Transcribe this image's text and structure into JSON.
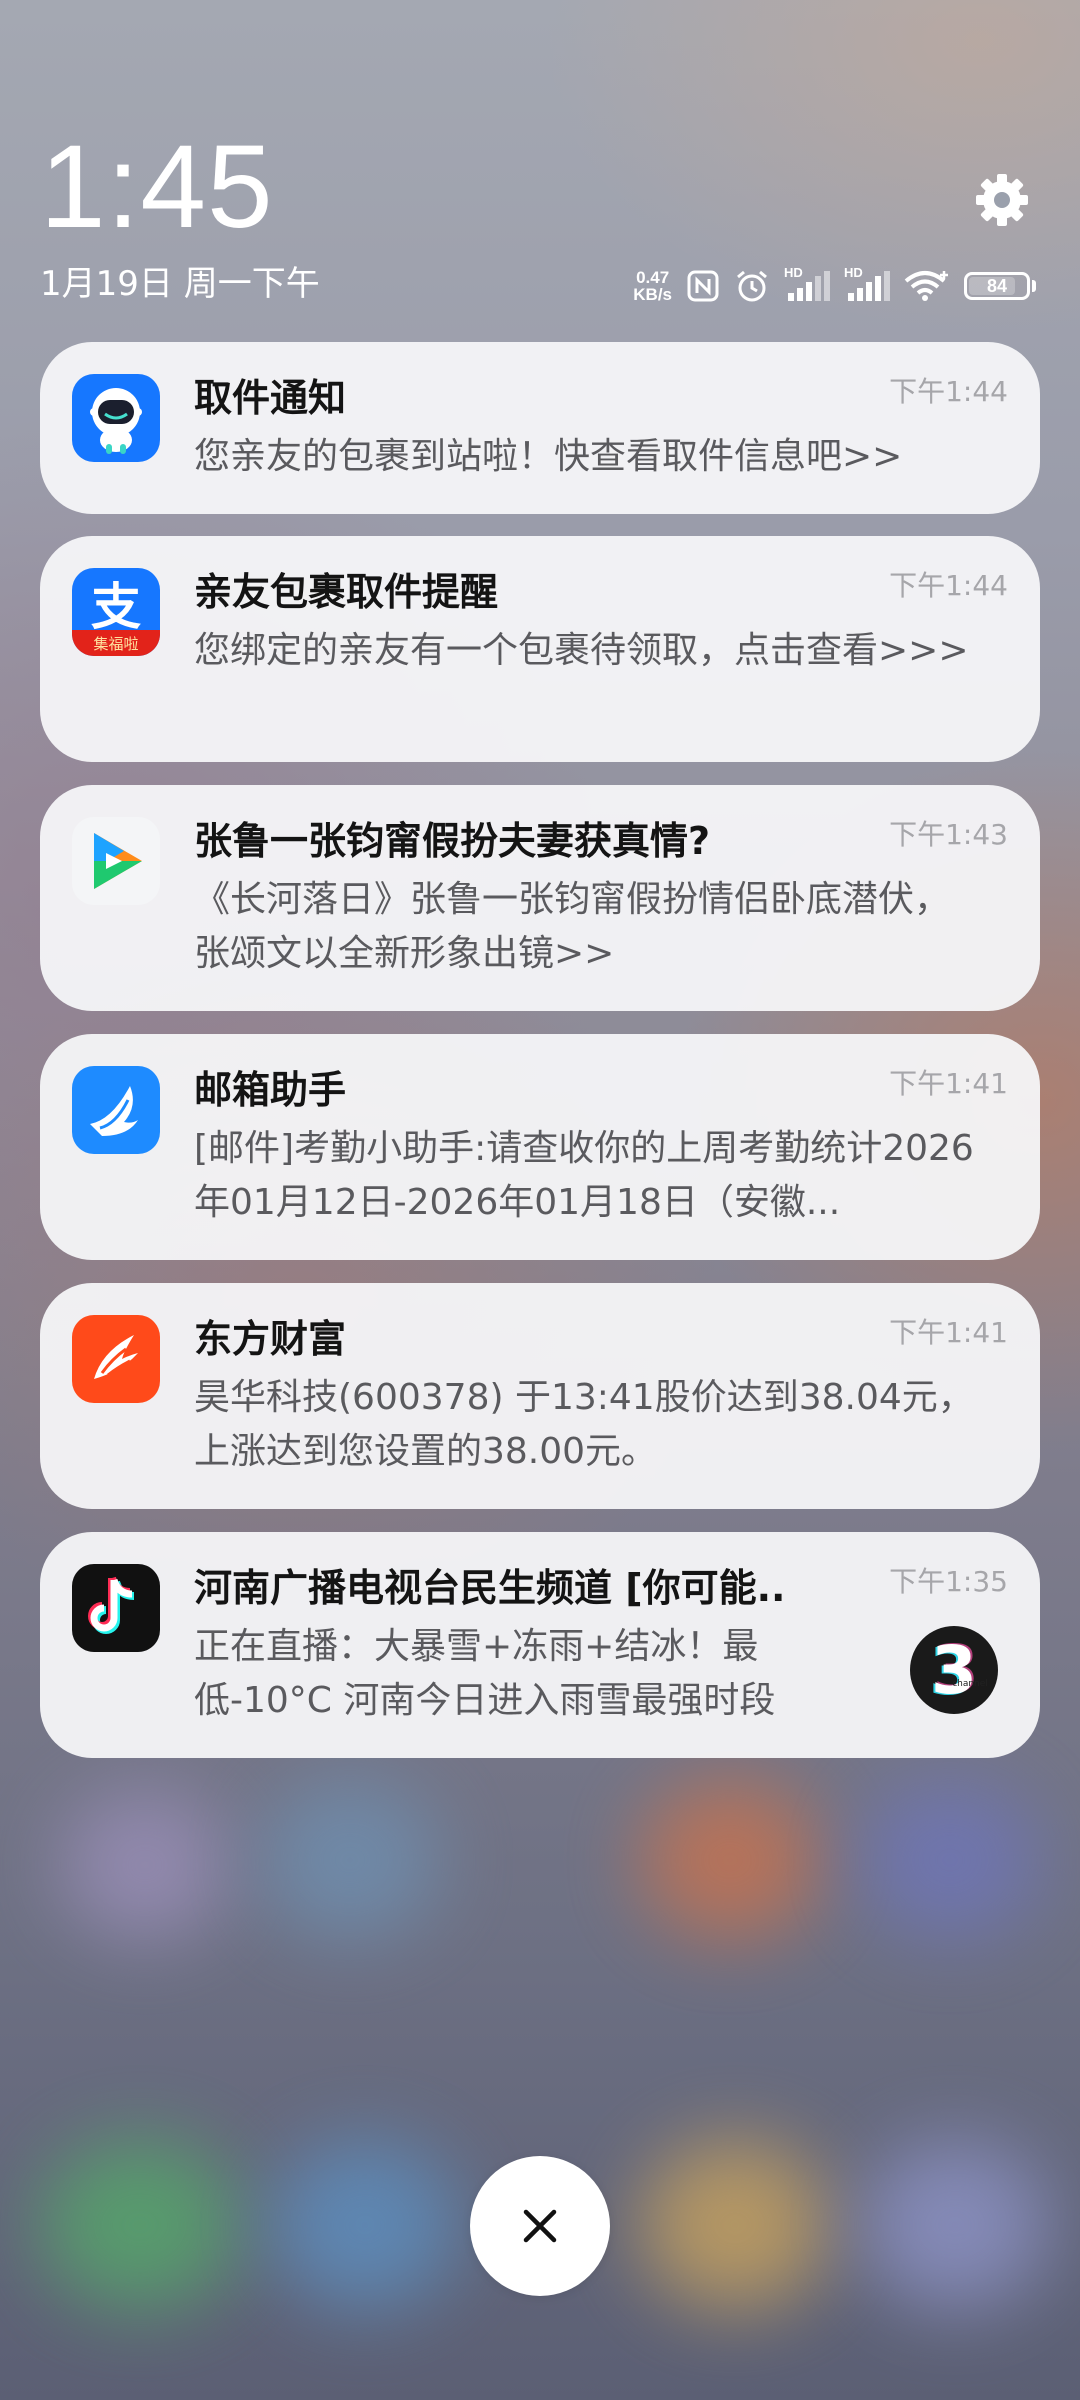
{
  "lockscreen": {
    "time": "1:45",
    "date": "1月19日 周一下午"
  },
  "status_bar": {
    "net_speed_value": "0.47",
    "net_speed_unit": "KB/s",
    "sim1_label": "HD",
    "sim2_label": "HD",
    "battery_level": "84",
    "icons": [
      "settings-icon",
      "nfc-icon",
      "alarm-icon",
      "signal-icon",
      "wifi-icon",
      "battery-icon"
    ]
  },
  "notifications": [
    {
      "app_icon": "package-robot-icon",
      "title": "取件通知",
      "time": "下午1:44",
      "body": "您亲友的包裹到站啦！快查看取件信息吧>>"
    },
    {
      "app_icon": "alipay-icon",
      "icon_caption": "集福啦",
      "title": "亲友包裹取件提醒",
      "time": "下午1:44",
      "body": "您绑定的亲友有一个包裹待领取，点击查看>>>"
    },
    {
      "app_icon": "video-play-icon",
      "title": "张鲁一张钧甯假扮夫妻获真情?",
      "time": "下午1:43",
      "body": "《长河落日》张鲁一张钧甯假扮情侣卧底潜伏，张颂文以全新形象出镜>>"
    },
    {
      "app_icon": "mail-assistant-icon",
      "title": "邮箱助手",
      "time": "下午1:41",
      "body": "[邮件]考勤小助手:请查收你的上周考勤统计2026年01月12日-2026年01月18日（安徽..."
    },
    {
      "app_icon": "eastmoney-icon",
      "title": "东方财富",
      "time": "下午1:41",
      "body": "昊华科技(600378) 于13:41股价达到38.04元，上涨达到您设置的38.00元。"
    },
    {
      "app_icon": "douyin-icon",
      "title": "河南广播电视台民生频道 [你可能..",
      "time": "下午1:35",
      "body": "正在直播：大暴雪+冻雨+结冰！最低-10°C 河南今日进入雨雪最强时段",
      "thumbnail_icon": "channel-3-logo-icon",
      "thumbnail_caption": "channel"
    }
  ],
  "actions": {
    "clear_all_icon": "close-icon"
  },
  "colors": {
    "card_background": "#f6f6f8",
    "title_text": "#141414",
    "body_text": "#5a5a5e",
    "time_text": "#a6a6aa"
  }
}
